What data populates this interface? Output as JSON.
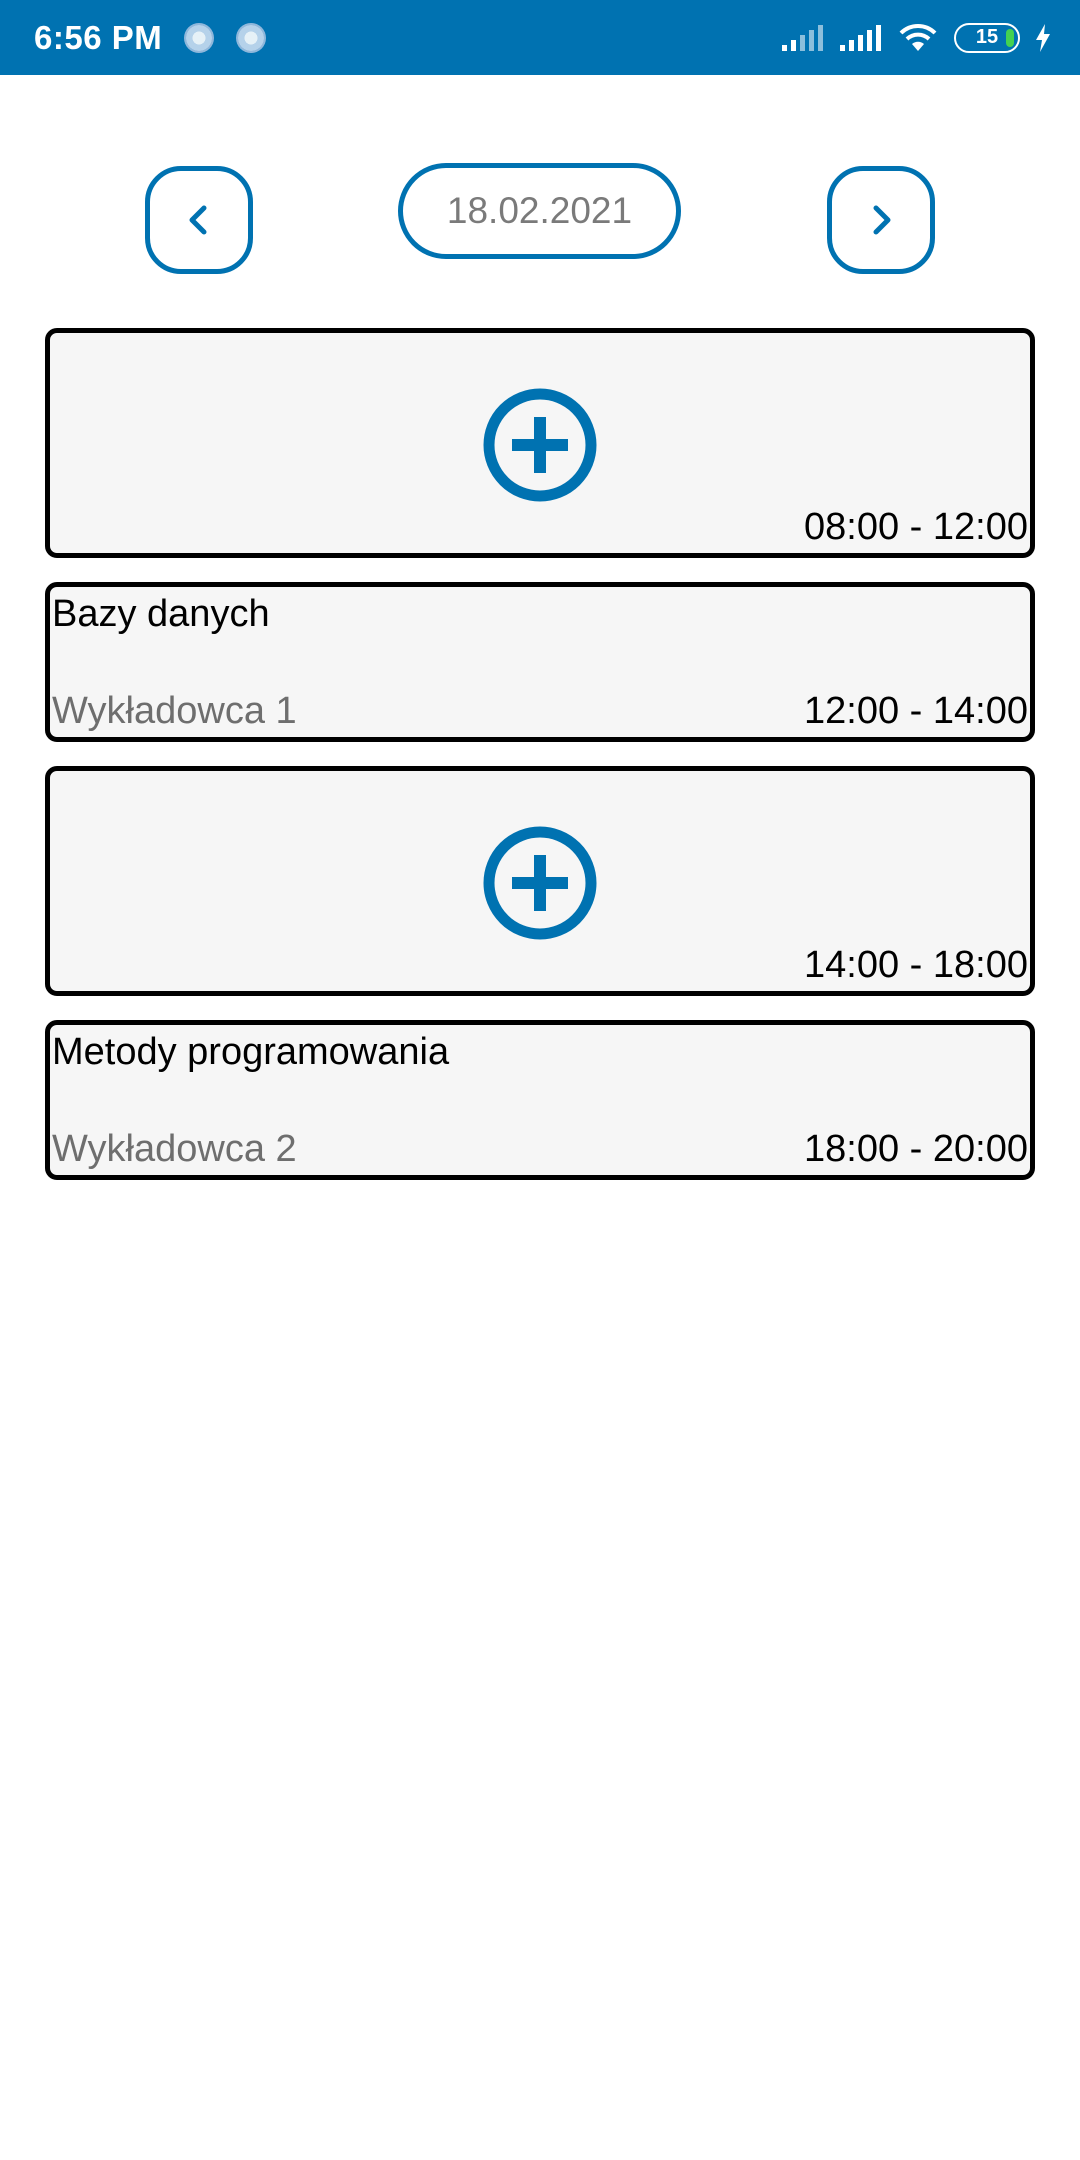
{
  "status_bar": {
    "time": "6:56 PM",
    "battery_level": "15",
    "icons": [
      "app-notification-icon",
      "app-notification-icon",
      "signal-icon",
      "signal-icon",
      "wifi-icon",
      "battery-icon",
      "charging-icon"
    ],
    "background_color": "#0072b1"
  },
  "date_nav": {
    "date": "18.02.2021",
    "prev_icon": "chevron-left-icon",
    "next_icon": "chevron-right-icon"
  },
  "slots": [
    {
      "type": "empty",
      "time": "08:00 - 12:00",
      "icon": "add-circle-icon"
    },
    {
      "type": "class",
      "title": "Bazy danych",
      "lecturer": "Wykładowca 1",
      "time": "12:00 - 14:00"
    },
    {
      "type": "empty",
      "time": "14:00 - 18:00",
      "icon": "add-circle-icon"
    },
    {
      "type": "class",
      "title": "Metody programowania",
      "lecturer": "Wykładowca 2",
      "time": "18:00 - 20:00"
    }
  ],
  "colors": {
    "accent": "#0072b1",
    "card_background": "#f6f6f6",
    "card_border": "#000000",
    "secondary_text": "#6e6e6e"
  }
}
